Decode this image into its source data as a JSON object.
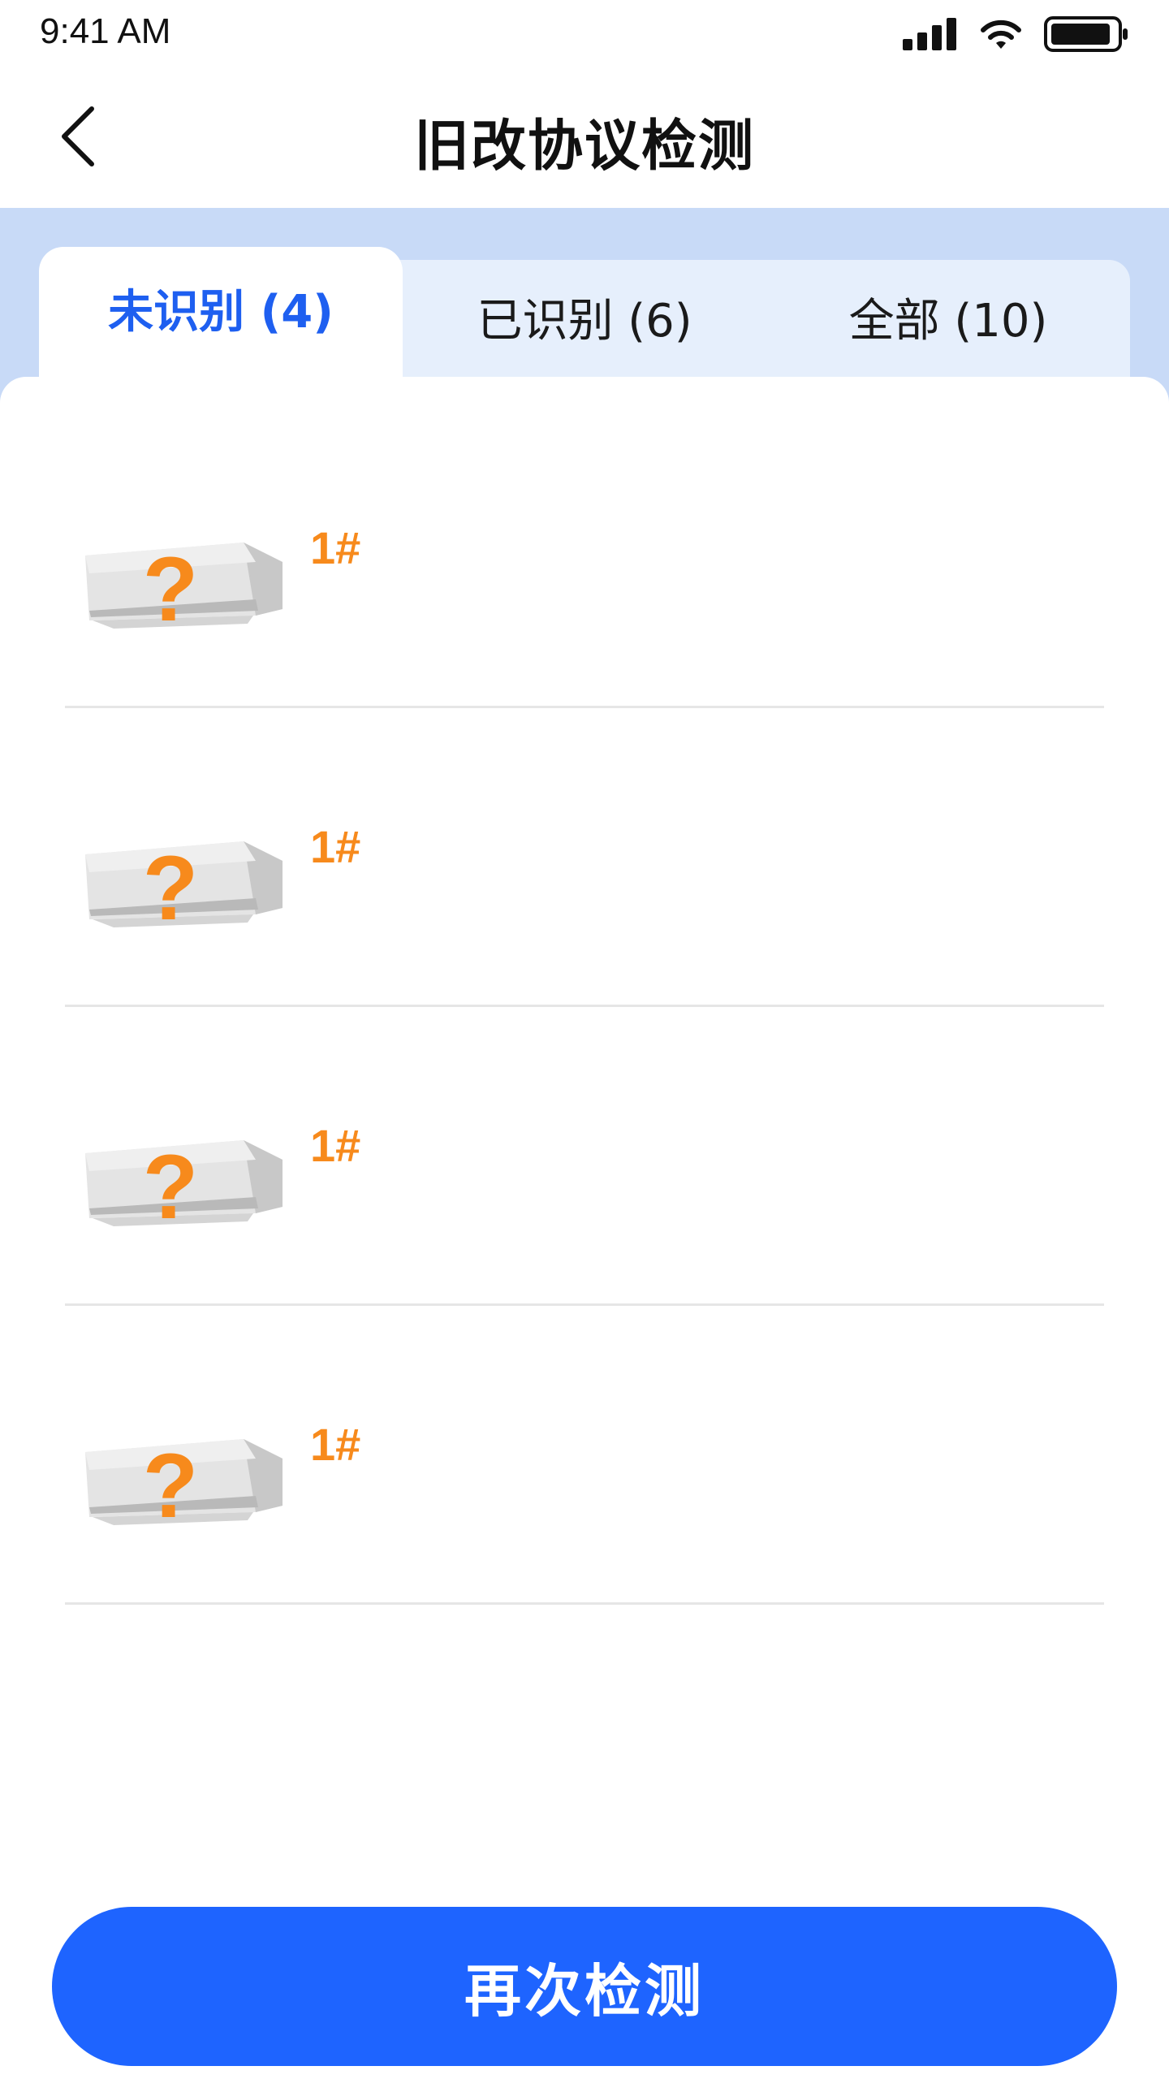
{
  "status_bar": {
    "time": "9:41 AM"
  },
  "header": {
    "title": "旧改协议检测"
  },
  "tabs": [
    {
      "label": "未识别 (4)",
      "active": true
    },
    {
      "label": "已识别 (6)",
      "active": false
    },
    {
      "label": "全部 (10)",
      "active": false
    }
  ],
  "list": {
    "items": [
      {
        "label": "1#",
        "icon": "unknown-air-conditioner-icon"
      },
      {
        "label": "1#",
        "icon": "unknown-air-conditioner-icon"
      },
      {
        "label": "1#",
        "icon": "unknown-air-conditioner-icon"
      },
      {
        "label": "1#",
        "icon": "unknown-air-conditioner-icon"
      }
    ]
  },
  "footer": {
    "button_label": "再次检测"
  },
  "colors": {
    "accent": "#1e64ff",
    "active_tab_text": "#1e5ff0",
    "warning_orange": "#f78a1c",
    "tab_band": "#c8daf7",
    "tab_strip": "#e6effc"
  }
}
